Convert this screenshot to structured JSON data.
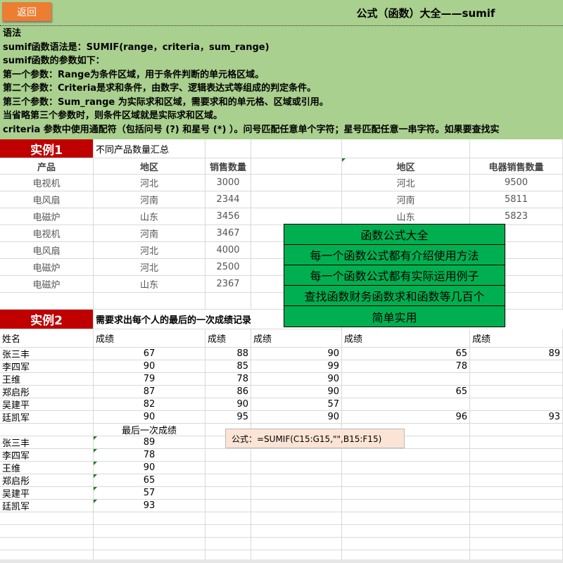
{
  "header": {
    "back_label": "返回",
    "title": "公式（函数）大全——sumif"
  },
  "syntax_lines": [
    "语法",
    "sumif函数语法是：SUMIF(range，criteria，sum_range)",
    "sumif函数的参数如下：",
    "第一个参数：Range为条件区域，用于条件判断的单元格区域。",
    "第二个参数：Criteria是求和条件，由数字、逻辑表达式等组成的判定条件。",
    "第三个参数：Sum_range 为实际求和区域，需要求和的单元格、区域或引用。",
    "当省略第三个参数时，则条件区域就是实际求和区域。",
    "criteria 参数中使用通配符（包括问号 (?) 和星号 (*) ）。问号匹配任意单个字符；星号匹配任意一串字符。如果要查找实"
  ],
  "example1": {
    "label": "实例1",
    "desc": "不同产品数量汇总",
    "headers": [
      "产品",
      "地区",
      "销售数量"
    ],
    "rows": [
      [
        "电视机",
        "河北",
        "3000"
      ],
      [
        "电风扇",
        "河南",
        "2344"
      ],
      [
        "电磁炉",
        "山东",
        "3456"
      ],
      [
        "电视机",
        "河南",
        "3467"
      ],
      [
        "电风扇",
        "河北",
        "4000"
      ],
      [
        "电磁炉",
        "河北",
        "2500"
      ],
      [
        "电磁炉",
        "山东",
        "2367"
      ]
    ],
    "summary_headers": [
      "地区",
      "电器销售数量"
    ],
    "summary_rows": [
      [
        "河北",
        "9500"
      ],
      [
        "河南",
        "5811"
      ],
      [
        "山东",
        "5823"
      ]
    ]
  },
  "menu": [
    "函数公式大全",
    "每一个函数公式都有介绍使用方法",
    "每一个函数公式都有实际运用例子",
    "查找函数财务函数求和函数等几百个",
    "简单实用"
  ],
  "example2": {
    "label": "实例2",
    "desc": "需要求出每个人的最后的一次成绩记录",
    "headers": [
      "姓名",
      "成绩",
      "成绩",
      "成绩",
      "成绩",
      "成绩"
    ],
    "rows": [
      [
        "张三丰",
        "67",
        "88",
        "90",
        "65",
        "89"
      ],
      [
        "李四军",
        "90",
        "85",
        "99",
        "78",
        ""
      ],
      [
        "王维",
        "79",
        "78",
        "90",
        "",
        ""
      ],
      [
        "郑启彤",
        "87",
        "86",
        "90",
        "65",
        ""
      ],
      [
        "吴建平",
        "82",
        "90",
        "57",
        "",
        ""
      ],
      [
        "廷凯军",
        "90",
        "95",
        "90",
        "96",
        "93"
      ]
    ],
    "result_header": "最后一次成绩",
    "results": [
      [
        "张三丰",
        "89"
      ],
      [
        "李四军",
        "78"
      ],
      [
        "王维",
        "90"
      ],
      [
        "郑启彤",
        "65"
      ],
      [
        "吴建平",
        "57"
      ],
      [
        "廷凯军",
        "93"
      ]
    ],
    "formula": "公式：=SUMIF(C15:G15,\"\",B15:F15)"
  }
}
